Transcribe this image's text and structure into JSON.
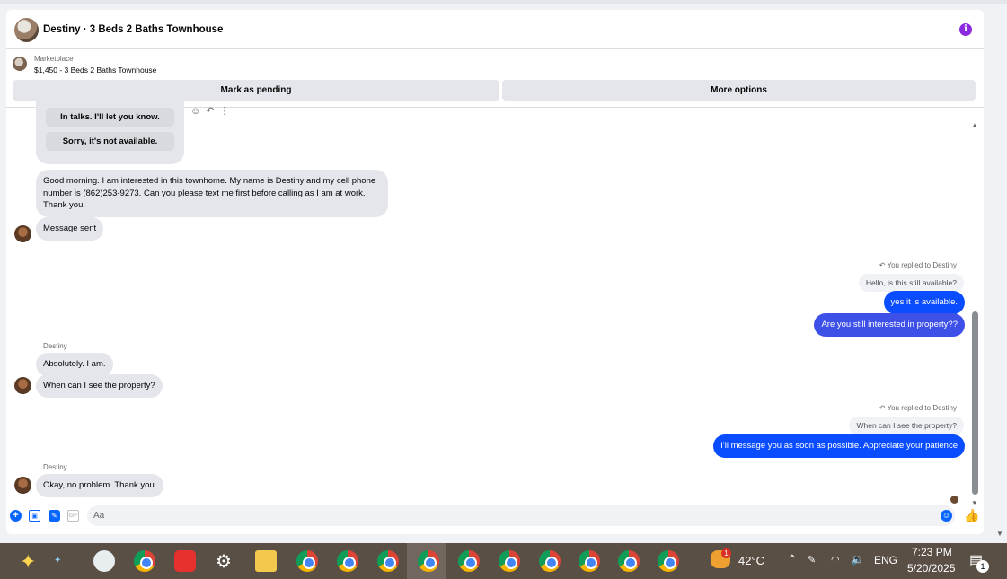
{
  "header": {
    "title": "Destiny · 3 Beds 2 Baths Townhouse",
    "info_icon": "i"
  },
  "marketplace": {
    "label": "Marketplace",
    "item": "$1,450 - 3 Beds 2 Baths Townhouse",
    "mark_pending": "Mark as pending",
    "more_options": "More options"
  },
  "quick_replies": [
    "In talks. I'll let you know.",
    "Sorry, it's not available."
  ],
  "messages": {
    "incoming_1": "Good morning. I am interested in this townhome. My name is Destiny and my cell phone number is (862)253-9273. Can you please text me first before calling as I am at work. Thank you.",
    "incoming_2": "Message sent",
    "replied_label": "You replied to Destiny",
    "reply_1_quote": "Hello, is this still available?",
    "out_1": "yes it is available.",
    "out_2": "Are you still interested in property??",
    "sender_name": "Destiny",
    "incoming_3": "Absolutely. I am.",
    "incoming_4": "When can I see the property?",
    "reply_2_quote": "When can I see the property?",
    "out_3": "I'll message you as soon as possible. Appreciate your patience",
    "incoming_5": "Okay, no problem. Thank you."
  },
  "composer": {
    "placeholder": "Aa",
    "gif": "GIF"
  },
  "taskbar": {
    "temperature": "42°C",
    "language": "ENG",
    "time": "7:23 PM",
    "date": "5/20/2025",
    "notification_count": "1",
    "weather_badge": "1"
  },
  "colors": {
    "accent": "#0a4cff",
    "info": "#8a2be2",
    "bubble_in": "#e4e6eb"
  }
}
